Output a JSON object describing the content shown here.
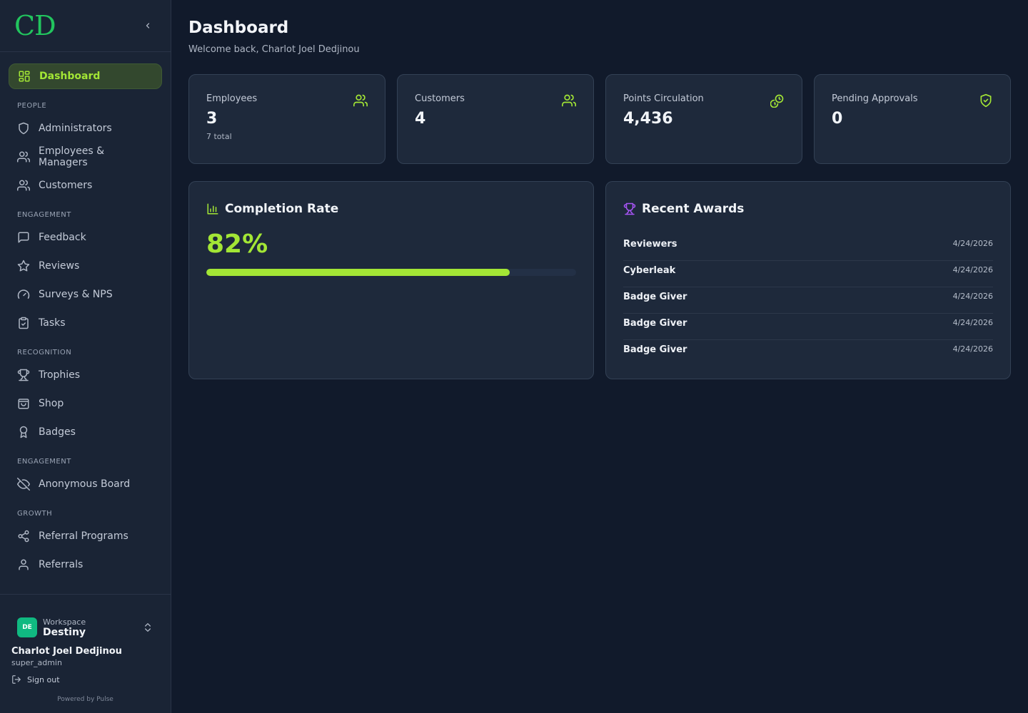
{
  "brand": {
    "logo_text": "CD",
    "accent": "#a3e635",
    "logo_color": "#22c55e"
  },
  "sidebar": {
    "active": {
      "label": "Dashboard",
      "icon": "dashboard-icon"
    },
    "sections": [
      {
        "title": "PEOPLE",
        "items": [
          {
            "label": "Administrators",
            "icon": "shield-icon"
          },
          {
            "label": "Employees & Managers",
            "icon": "users-icon"
          },
          {
            "label": "Customers",
            "icon": "users-icon"
          }
        ]
      },
      {
        "title": "ENGAGEMENT",
        "items": [
          {
            "label": "Feedback",
            "icon": "message-square-icon"
          },
          {
            "label": "Reviews",
            "icon": "star-icon"
          },
          {
            "label": "Surveys & NPS",
            "icon": "gauge-icon"
          },
          {
            "label": "Tasks",
            "icon": "clipboard-check-icon"
          }
        ]
      },
      {
        "title": "RECOGNITION",
        "items": [
          {
            "label": "Trophies",
            "icon": "trophy-icon"
          },
          {
            "label": "Shop",
            "icon": "shopping-bag-icon"
          },
          {
            "label": "Badges",
            "icon": "award-icon"
          }
        ]
      },
      {
        "title": "ENGAGEMENT",
        "items": [
          {
            "label": "Anonymous Board",
            "icon": "eye-off-icon"
          }
        ]
      },
      {
        "title": "GROWTH",
        "items": [
          {
            "label": "Referral Programs",
            "icon": "share-icon"
          },
          {
            "label": "Referrals",
            "icon": "user-icon"
          }
        ]
      }
    ],
    "workspace": {
      "label": "Workspace",
      "name": "Destiny",
      "initials": "DE"
    },
    "user": {
      "name": "Charlot Joel Dedjinou",
      "role": "super_admin"
    },
    "signout_label": "Sign out",
    "powered_by": "Powered by Pulse"
  },
  "header": {
    "title": "Dashboard",
    "subtitle": "Welcome back, Charlot Joel Dedjinou"
  },
  "stats": [
    {
      "label": "Employees",
      "value": "3",
      "sub": "7 total",
      "icon": "users-icon"
    },
    {
      "label": "Customers",
      "value": "4",
      "sub": "",
      "icon": "users-icon"
    },
    {
      "label": "Points Circulation",
      "value": "4,436",
      "sub": "",
      "icon": "coins-icon"
    },
    {
      "label": "Pending Approvals",
      "value": "0",
      "sub": "",
      "icon": "shield-check-icon"
    }
  ],
  "completion": {
    "title": "Completion Rate",
    "value_label": "82%",
    "fraction": 0.82
  },
  "awards": {
    "title": "Recent Awards",
    "items": [
      {
        "name": "Reviewers",
        "date": "4/24/2026"
      },
      {
        "name": "Cyberleak",
        "date": "4/24/2026"
      },
      {
        "name": "Badge Giver",
        "date": "4/24/2026"
      },
      {
        "name": "Badge Giver",
        "date": "4/24/2026"
      },
      {
        "name": "Badge Giver",
        "date": "4/24/2026"
      }
    ]
  }
}
